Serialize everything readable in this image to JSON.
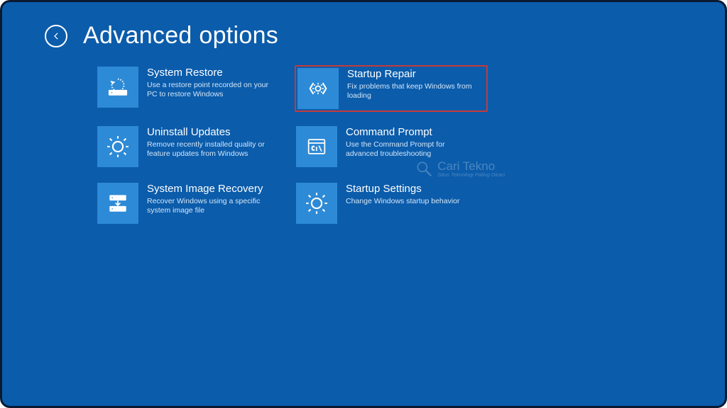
{
  "header": {
    "title": "Advanced options"
  },
  "tiles": {
    "system_restore": {
      "title": "System Restore",
      "desc": "Use a restore point recorded on your PC to restore Windows"
    },
    "startup_repair": {
      "title": "Startup Repair",
      "desc": "Fix problems that keep Windows from loading"
    },
    "uninstall_updates": {
      "title": "Uninstall Updates",
      "desc": "Remove recently installed quality or feature updates from Windows"
    },
    "command_prompt": {
      "title": "Command Prompt",
      "desc": "Use the Command Prompt for advanced troubleshooting"
    },
    "system_image_recovery": {
      "title": "System Image Recovery",
      "desc": "Recover Windows using a specific system image file"
    },
    "startup_settings": {
      "title": "Startup Settings",
      "desc": "Change Windows startup behavior"
    }
  },
  "watermark": {
    "main": "Cari Tekno",
    "sub": "Situs Teknologi Paling Dicari"
  },
  "colors": {
    "background": "#0b5cab",
    "tile_icon_bg": "#2d8ad6",
    "highlight_border": "#c43a3a",
    "frame_border": "#0a1a33"
  }
}
